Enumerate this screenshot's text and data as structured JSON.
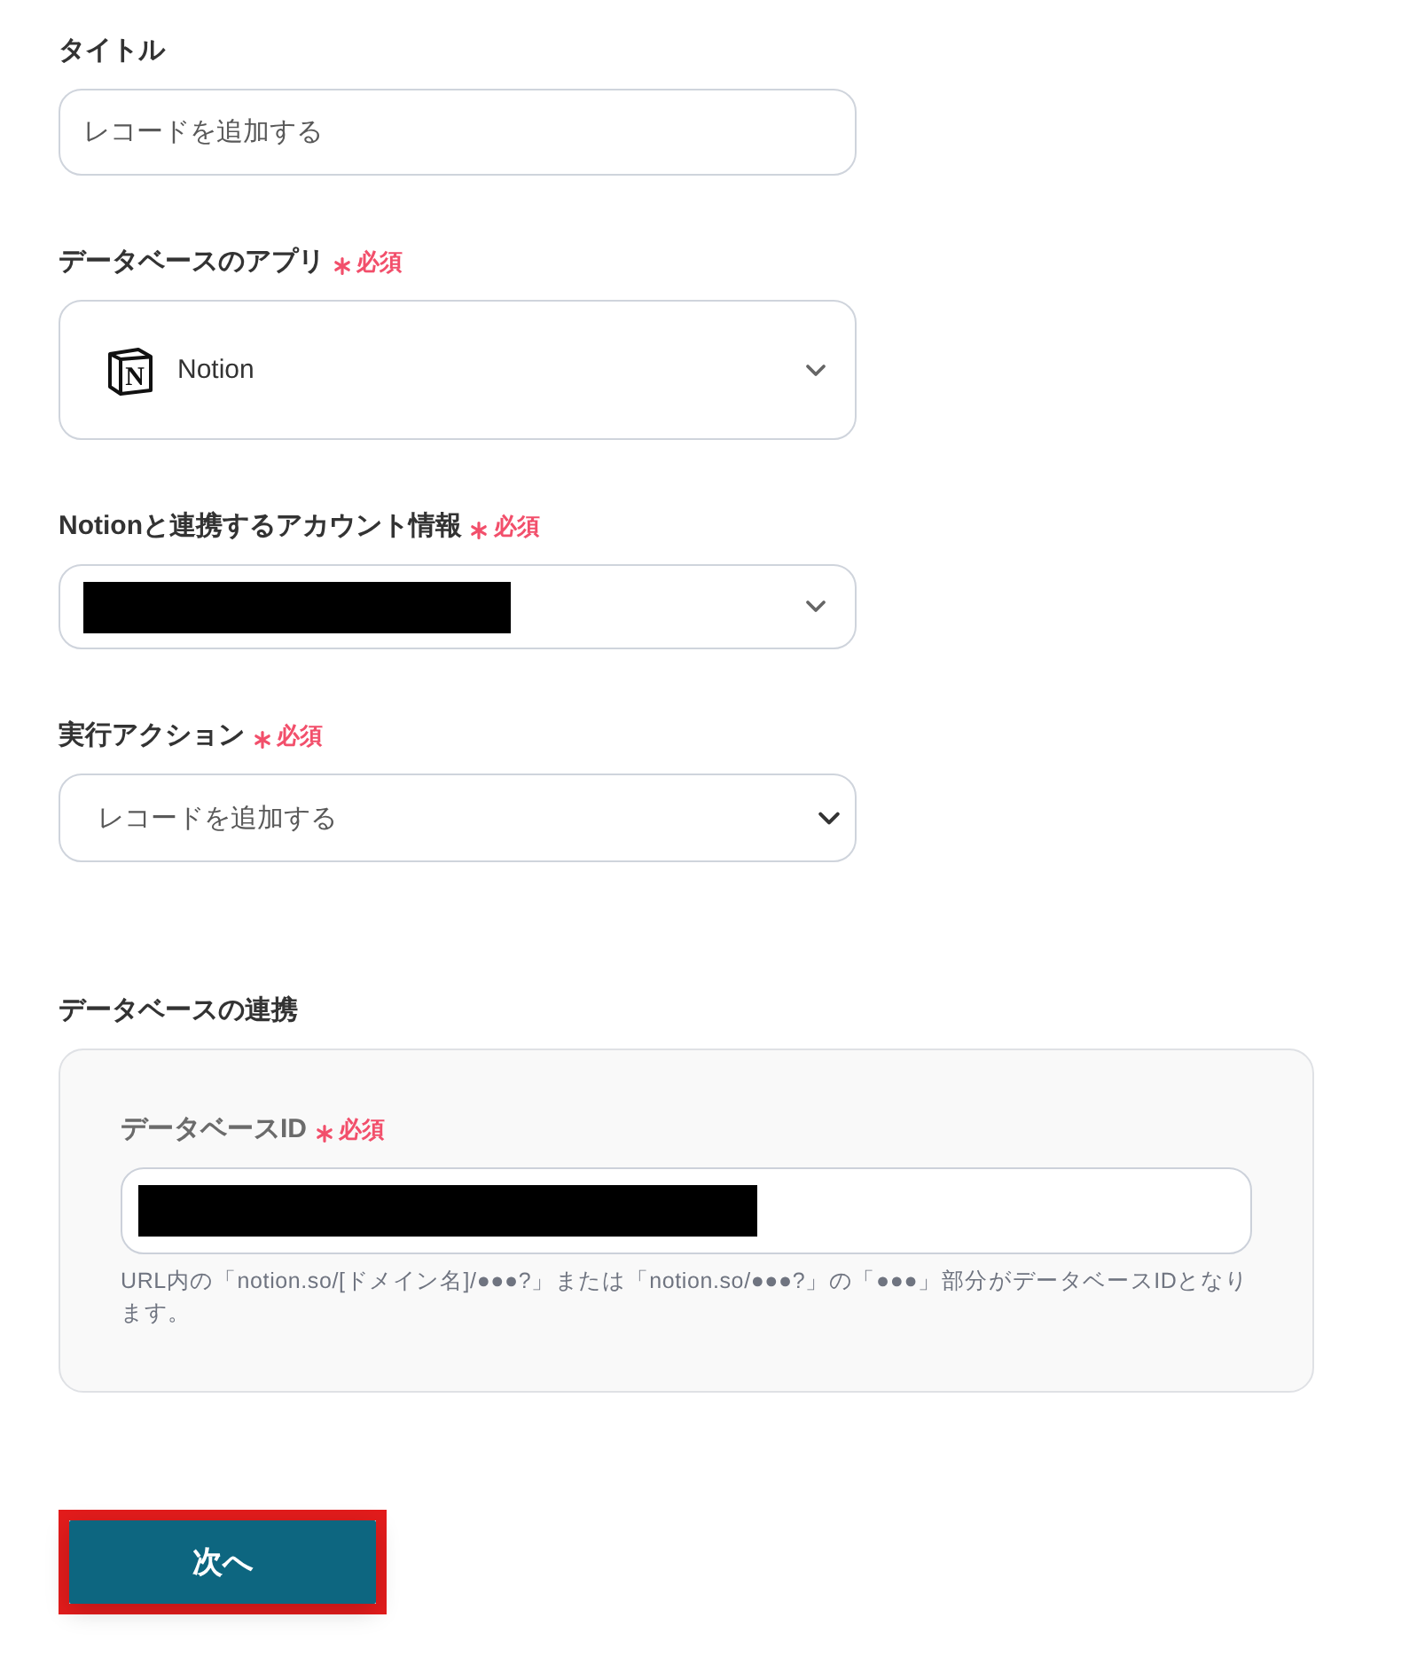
{
  "form": {
    "fields": [
      {
        "kind": "input",
        "label": "タイトル",
        "required": false,
        "value": "レコードを追加する"
      },
      {
        "kind": "app-select",
        "label": "データベースのアプリ",
        "required": true,
        "required_text": "必須",
        "logo_letter": "N",
        "value": "Notion"
      },
      {
        "kind": "select",
        "label": "Notionと連携するアカウント情報",
        "required": true,
        "required_text": "必須",
        "redacted": true
      },
      {
        "kind": "native-select",
        "label": "実行アクション",
        "required": true,
        "required_text": "必須",
        "value": "レコードを追加する"
      }
    ]
  },
  "database_link": {
    "title": "データベースの連携",
    "fields": [
      {
        "kind": "input",
        "label": "データベースID",
        "required": true,
        "required_text": "必須",
        "redacted": true,
        "help": "URL内の「notion.so/[ドメイン名]/●●●?」または「notion.so/●●●?」の「●●●」部分がデータベースIDとなります。"
      }
    ]
  },
  "next_button": {
    "label": "次へ",
    "highlighted": true
  }
}
